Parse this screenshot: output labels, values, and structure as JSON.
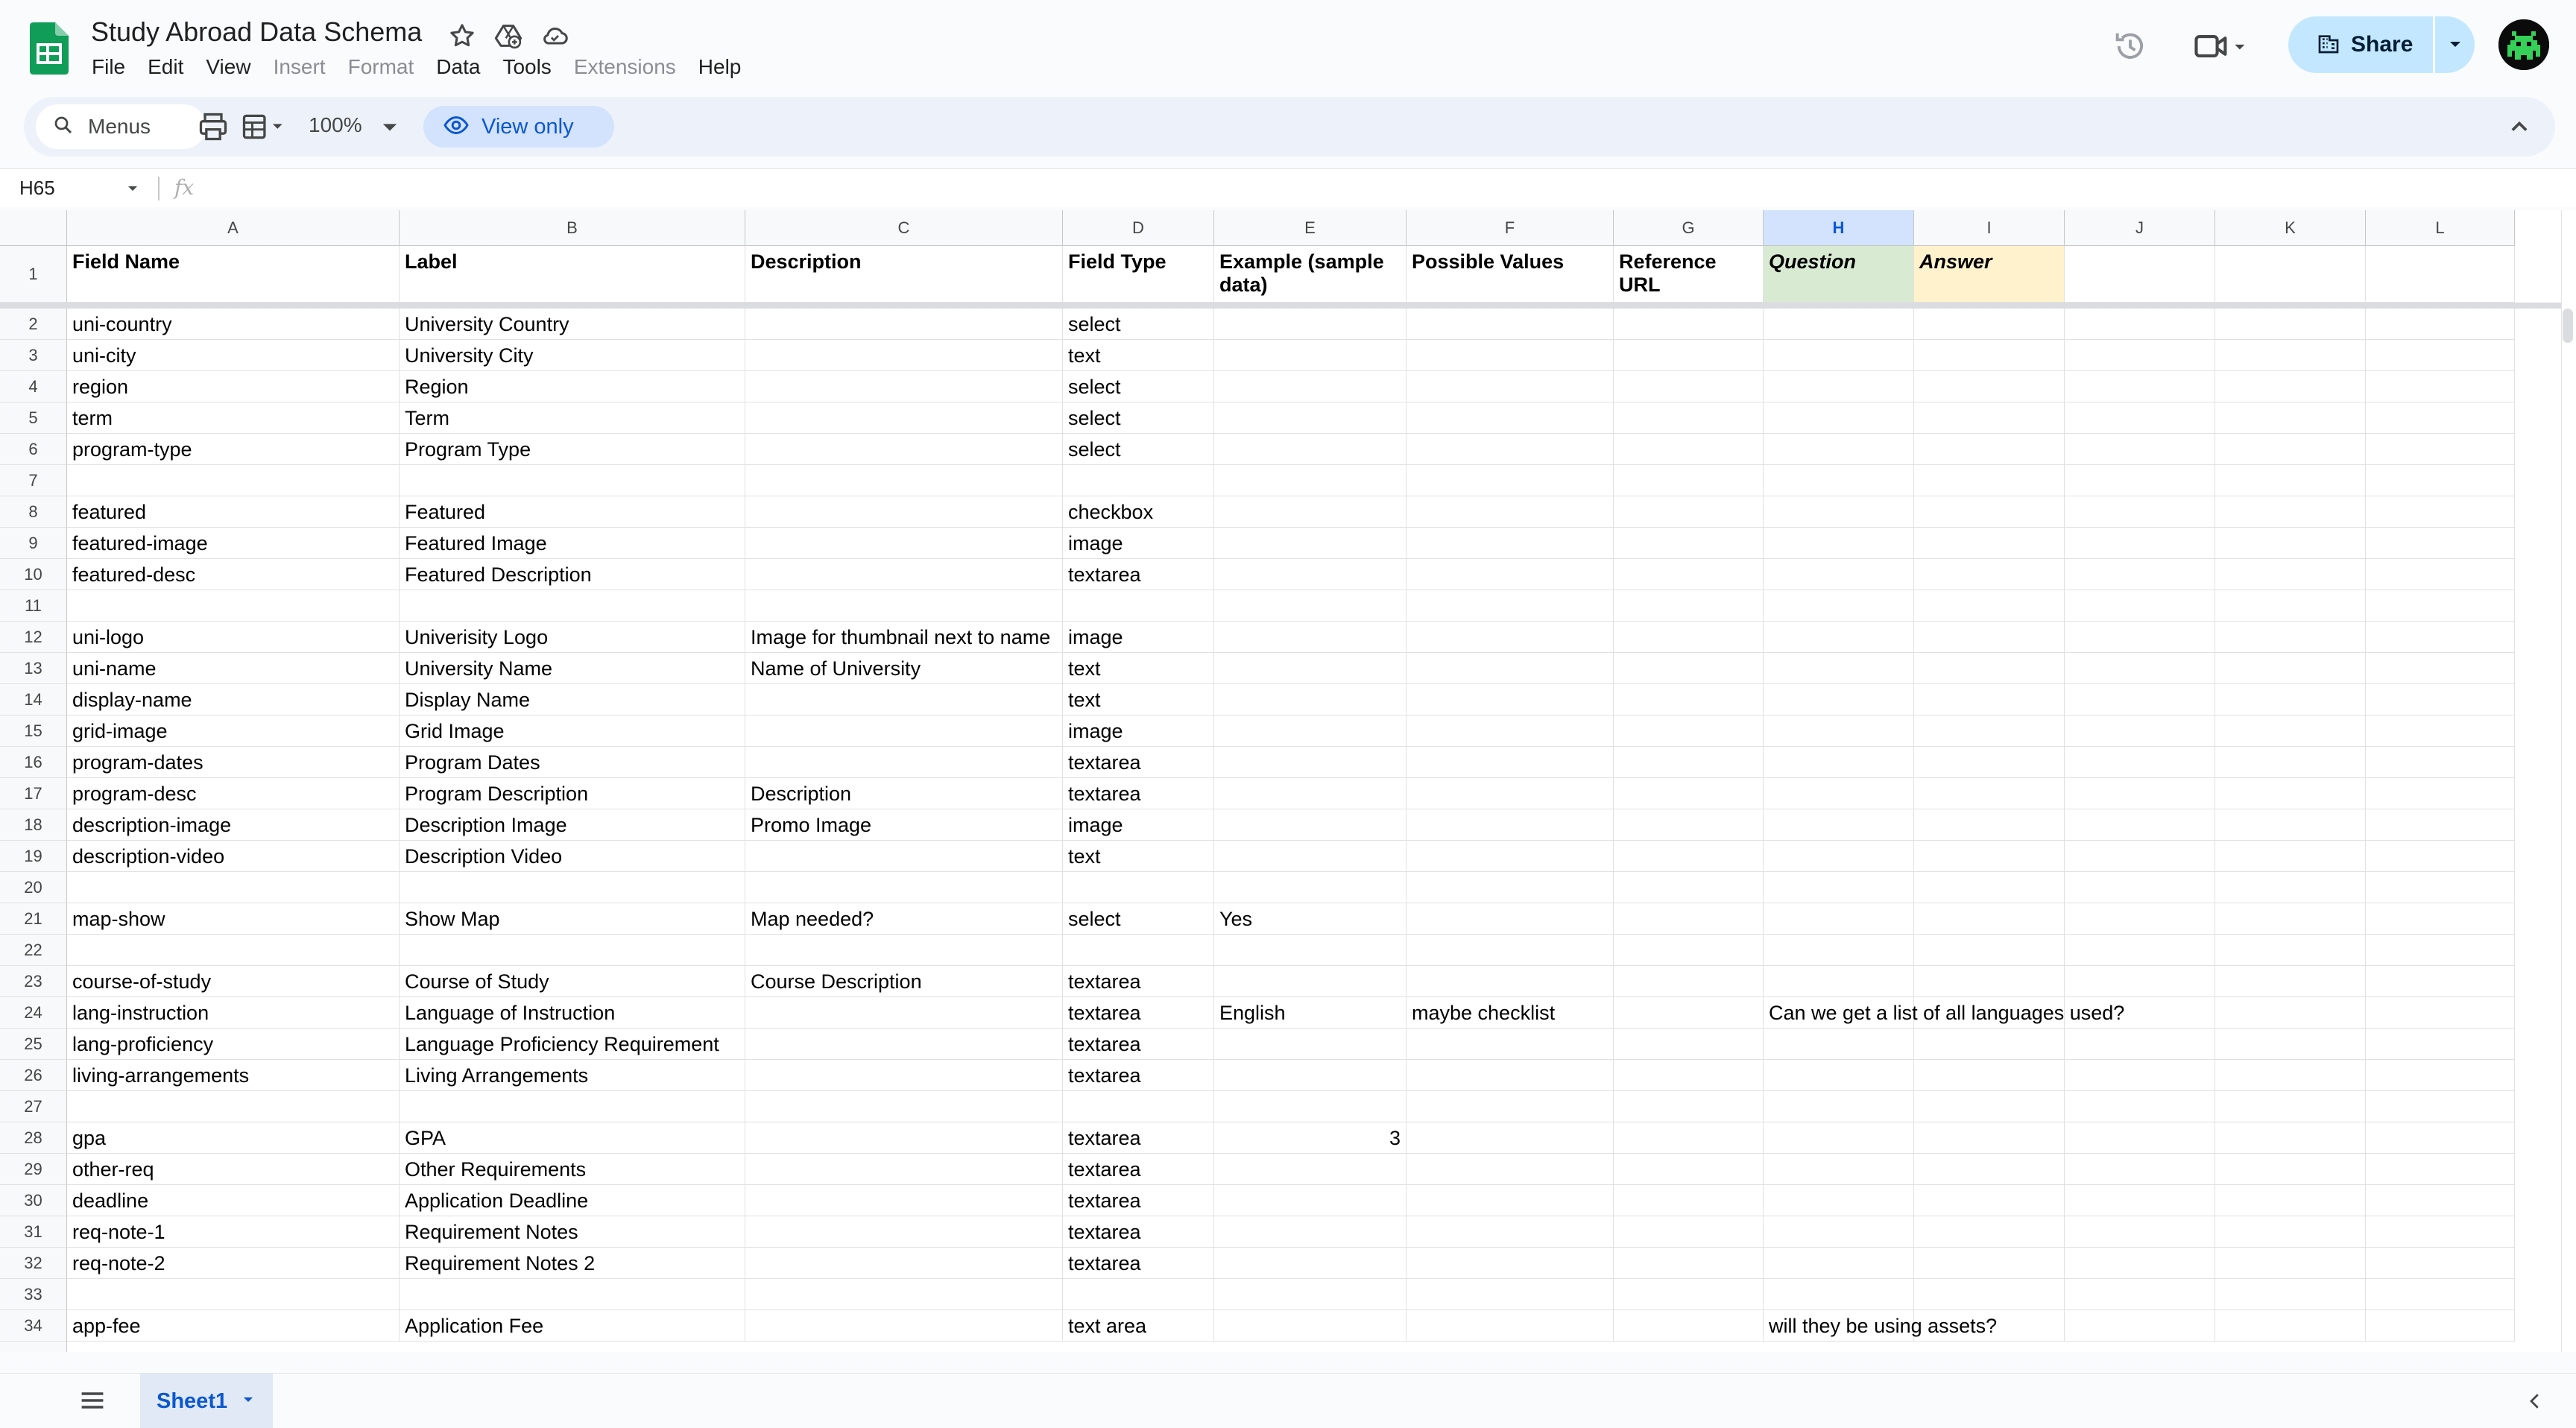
{
  "app": {
    "title": "Study Abroad Data Schema",
    "brand_color": "#0f9d58",
    "menu": [
      "File",
      "Edit",
      "View",
      "Insert",
      "Format",
      "Data",
      "Tools",
      "Extensions",
      "Help"
    ],
    "disabled_menus": [
      "Insert",
      "Format",
      "Extensions"
    ]
  },
  "header_actions": {
    "share_label": "Share",
    "share_color": "#c2e7ff"
  },
  "toolbar": {
    "menus_label": "Menus",
    "zoom": "100%",
    "view_only_label": "View only"
  },
  "formula_bar": {
    "cell_ref": "H65",
    "fx_label": "fx",
    "value": ""
  },
  "grid": {
    "columns": [
      "A",
      "B",
      "C",
      "D",
      "E",
      "F",
      "G",
      "H",
      "I",
      "J",
      "K",
      "L"
    ],
    "selected_column": "H",
    "header_row": [
      "Field Name",
      "Label",
      "Description",
      "Field Type",
      "Example (sample data)",
      "Possible Values",
      "Reference URL",
      "Question",
      "Answer",
      "",
      "",
      ""
    ],
    "rows": [
      {
        "n": "2",
        "cells": [
          "uni-country",
          "University Country",
          "",
          "select",
          "",
          "",
          "",
          "",
          ""
        ]
      },
      {
        "n": "3",
        "cells": [
          "uni-city",
          "University City",
          "",
          "text",
          "",
          "",
          "",
          "",
          ""
        ]
      },
      {
        "n": "4",
        "cells": [
          "region",
          "Region",
          "",
          "select",
          "",
          "",
          "",
          "",
          ""
        ]
      },
      {
        "n": "5",
        "cells": [
          "term",
          "Term",
          "",
          "select",
          "",
          "",
          "",
          "",
          ""
        ]
      },
      {
        "n": "6",
        "cells": [
          "program-type",
          "Program Type",
          "",
          "select",
          "",
          "",
          "",
          "",
          ""
        ]
      },
      {
        "n": "7",
        "cells": [
          "",
          "",
          "",
          "",
          "",
          "",
          "",
          "",
          ""
        ]
      },
      {
        "n": "8",
        "cells": [
          "featured",
          "Featured",
          "",
          "checkbox",
          "",
          "",
          "",
          "",
          ""
        ]
      },
      {
        "n": "9",
        "cells": [
          "featured-image",
          "Featured Image",
          "",
          "image",
          "",
          "",
          "",
          "",
          ""
        ]
      },
      {
        "n": "10",
        "cells": [
          "featured-desc",
          "Featured Description",
          "",
          "textarea",
          "",
          "",
          "",
          "",
          ""
        ]
      },
      {
        "n": "11",
        "cells": [
          "",
          "",
          "",
          "",
          "",
          "",
          "",
          "",
          ""
        ]
      },
      {
        "n": "12",
        "cells": [
          "uni-logo",
          "Univerisity Logo",
          "Image for thumbnail next to name",
          "image",
          "",
          "",
          "",
          "",
          ""
        ]
      },
      {
        "n": "13",
        "cells": [
          "uni-name",
          "University Name",
          "Name of University",
          "text",
          "",
          "",
          "",
          "",
          ""
        ]
      },
      {
        "n": "14",
        "cells": [
          "display-name",
          "Display Name",
          "",
          "text",
          "",
          "",
          "",
          "",
          ""
        ]
      },
      {
        "n": "15",
        "cells": [
          "grid-image",
          "Grid Image",
          "",
          "image",
          "",
          "",
          "",
          "",
          ""
        ]
      },
      {
        "n": "16",
        "cells": [
          "program-dates",
          "Program Dates",
          "",
          "textarea",
          "",
          "",
          "",
          "",
          ""
        ]
      },
      {
        "n": "17",
        "cells": [
          "program-desc",
          "Program Description",
          "Description",
          "textarea",
          "",
          "",
          "",
          "",
          ""
        ]
      },
      {
        "n": "18",
        "cells": [
          "description-image",
          "Description Image",
          "Promo Image",
          "image",
          "",
          "",
          "",
          "",
          ""
        ]
      },
      {
        "n": "19",
        "cells": [
          "description-video",
          "Description Video",
          "",
          "text",
          "",
          "",
          "",
          "",
          ""
        ]
      },
      {
        "n": "20",
        "cells": [
          "",
          "",
          "",
          "",
          "",
          "",
          "",
          "",
          ""
        ]
      },
      {
        "n": "21",
        "cells": [
          "map-show",
          "Show Map",
          "Map needed?",
          "select",
          "Yes",
          "",
          "",
          "",
          ""
        ]
      },
      {
        "n": "22",
        "cells": [
          "",
          "",
          "",
          "",
          "",
          "",
          "",
          "",
          ""
        ]
      },
      {
        "n": "23",
        "cells": [
          "course-of-study",
          "Course of Study",
          "Course Description",
          "textarea",
          "",
          "",
          "",
          "",
          ""
        ]
      },
      {
        "n": "24",
        "cells": [
          "lang-instruction",
          "Language of Instruction",
          "",
          "textarea",
          "English",
          "maybe checklist",
          "",
          "Can we get a list of all languages used?",
          ""
        ]
      },
      {
        "n": "25",
        "cells": [
          "lang-proficiency",
          "Language Proficiency Requirement",
          "",
          "textarea",
          "",
          "",
          "",
          "",
          ""
        ]
      },
      {
        "n": "26",
        "cells": [
          "living-arrangements",
          "Living Arrangements",
          "",
          "textarea",
          "",
          "",
          "",
          "",
          ""
        ]
      },
      {
        "n": "27",
        "cells": [
          "",
          "",
          "",
          "",
          "",
          "",
          "",
          "",
          ""
        ]
      },
      {
        "n": "28",
        "cells": [
          "gpa",
          "GPA",
          "",
          "textarea",
          "3",
          "",
          "",
          "",
          ""
        ]
      },
      {
        "n": "29",
        "cells": [
          "other-req",
          "Other Requirements",
          "",
          "textarea",
          "",
          "",
          "",
          "",
          ""
        ]
      },
      {
        "n": "30",
        "cells": [
          "deadline",
          "Application Deadline",
          "",
          "textarea",
          "",
          "",
          "",
          "",
          ""
        ]
      },
      {
        "n": "31",
        "cells": [
          "req-note-1",
          "Requirement Notes",
          "",
          "textarea",
          "",
          "",
          "",
          "",
          ""
        ]
      },
      {
        "n": "32",
        "cells": [
          "req-note-2",
          "Requirement Notes 2",
          "",
          "textarea",
          "",
          "",
          "",
          "",
          ""
        ]
      },
      {
        "n": "33",
        "cells": [
          "",
          "",
          "",
          "",
          "",
          "",
          "",
          "",
          ""
        ]
      },
      {
        "n": "34",
        "cells": [
          "app-fee",
          "Application Fee",
          "",
          "text area",
          "",
          "",
          "",
          "will they be using assets?",
          ""
        ]
      }
    ]
  },
  "sheets": {
    "active": "Sheet1"
  }
}
